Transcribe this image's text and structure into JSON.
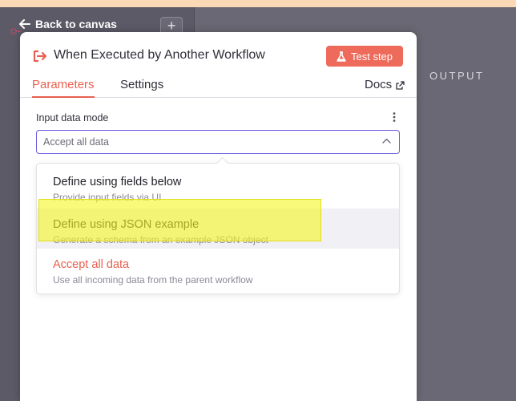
{
  "canvas": {
    "back_label": "Back to canvas",
    "plus_label": "+",
    "output_label": "OUTPUT"
  },
  "panel": {
    "node_title": "When Executed by Another Workflow",
    "test_step_label": "Test step",
    "tabs": [
      {
        "label": "Parameters",
        "active": true
      },
      {
        "label": "Settings",
        "active": false
      }
    ],
    "docs_label": "Docs",
    "field": {
      "label": "Input data mode",
      "value": "Accept all data"
    },
    "options": [
      {
        "title": "Define using fields below",
        "description": "Provide input fields via UI",
        "selected": false,
        "hovered": false
      },
      {
        "title": "Define using JSON example",
        "description": "Generate a schema from an example JSON object",
        "selected": false,
        "hovered": true
      },
      {
        "title": "Accept all data",
        "description": "Use all incoming data from the parent workflow",
        "selected": true,
        "hovered": false
      }
    ]
  },
  "colors": {
    "accent": "#e8604f",
    "test_button": "#ee6a5a",
    "select_border": "#6a5ce0",
    "highlight": "#f5f528"
  }
}
